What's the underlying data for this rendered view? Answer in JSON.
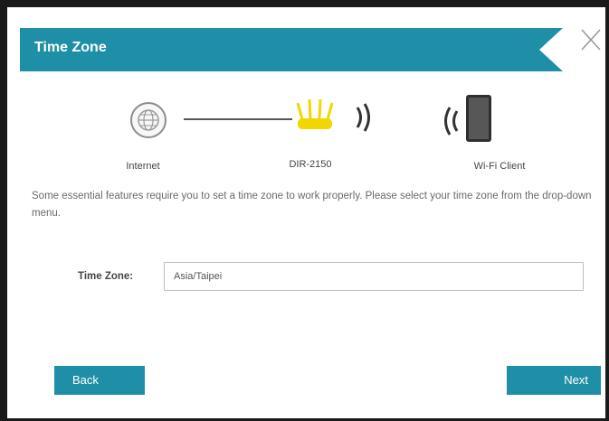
{
  "header": {
    "title": "Time Zone",
    "accent_color": "#1e8fa6"
  },
  "diagram": {
    "internet_label": "Internet",
    "router_label": "DIR-2150",
    "client_label": "Wi-Fi Client",
    "icons": [
      "globe-icon",
      "router-icon",
      "wireless-signal-icon",
      "tablet-icon"
    ]
  },
  "description": "Some essential features require you to set a time zone to work properly. Please select your time zone from the drop-down menu.",
  "form": {
    "time_zone_label": "Time Zone:",
    "time_zone_value": "Asia/Taipei"
  },
  "buttons": {
    "back_label": "Back",
    "next_label": "Next"
  }
}
